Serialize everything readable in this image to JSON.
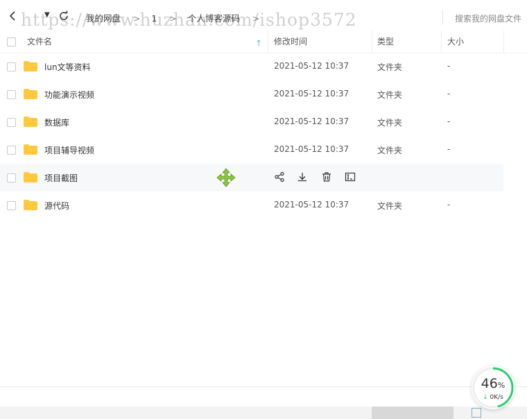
{
  "toolbar": {
    "back_icon": "chevron-left-icon",
    "dropdown_icon": "caret-down-icon",
    "refresh_icon": "refresh-icon",
    "breadcrumb": [
      "我的网盘",
      "1",
      "个人博客源码"
    ],
    "search_placeholder": "搜索我的网盘文件"
  },
  "watermark": "https://www.huzhan.com/ishop3572",
  "columns": {
    "name": "文件名",
    "modified": "修改时间",
    "type": "类型",
    "size": "大小"
  },
  "sort": {
    "column": "name",
    "direction": "ascending",
    "icon": "arrow-up-icon"
  },
  "files": [
    {
      "name": "lun文等资料",
      "modified": "2021-05-12 10:37",
      "type": "文件夹",
      "size": "-"
    },
    {
      "name": "功能演示视频",
      "modified": "2021-05-12 10:37",
      "type": "文件夹",
      "size": "-"
    },
    {
      "name": "数据库",
      "modified": "2021-05-12 10:37",
      "type": "文件夹",
      "size": "-"
    },
    {
      "name": "项目辅导视频",
      "modified": "2021-05-12 10:37",
      "type": "文件夹",
      "size": "-"
    },
    {
      "name": "项目截图",
      "modified": "",
      "type": "",
      "size": "",
      "hover": true
    },
    {
      "name": "源代码",
      "modified": "2021-05-12 10:37",
      "type": "文件夹",
      "size": "-"
    }
  ],
  "row_actions": [
    "share-icon",
    "download-icon",
    "delete-icon",
    "rename-icon"
  ],
  "speed_widget": {
    "percent": "46",
    "percent_unit": "%",
    "rate": "0K/s",
    "accent": "#2ecc71"
  },
  "colors": {
    "folder": "#ffc83d",
    "accent": "#2d8cf0",
    "hover_row": "#f6f8fa"
  }
}
